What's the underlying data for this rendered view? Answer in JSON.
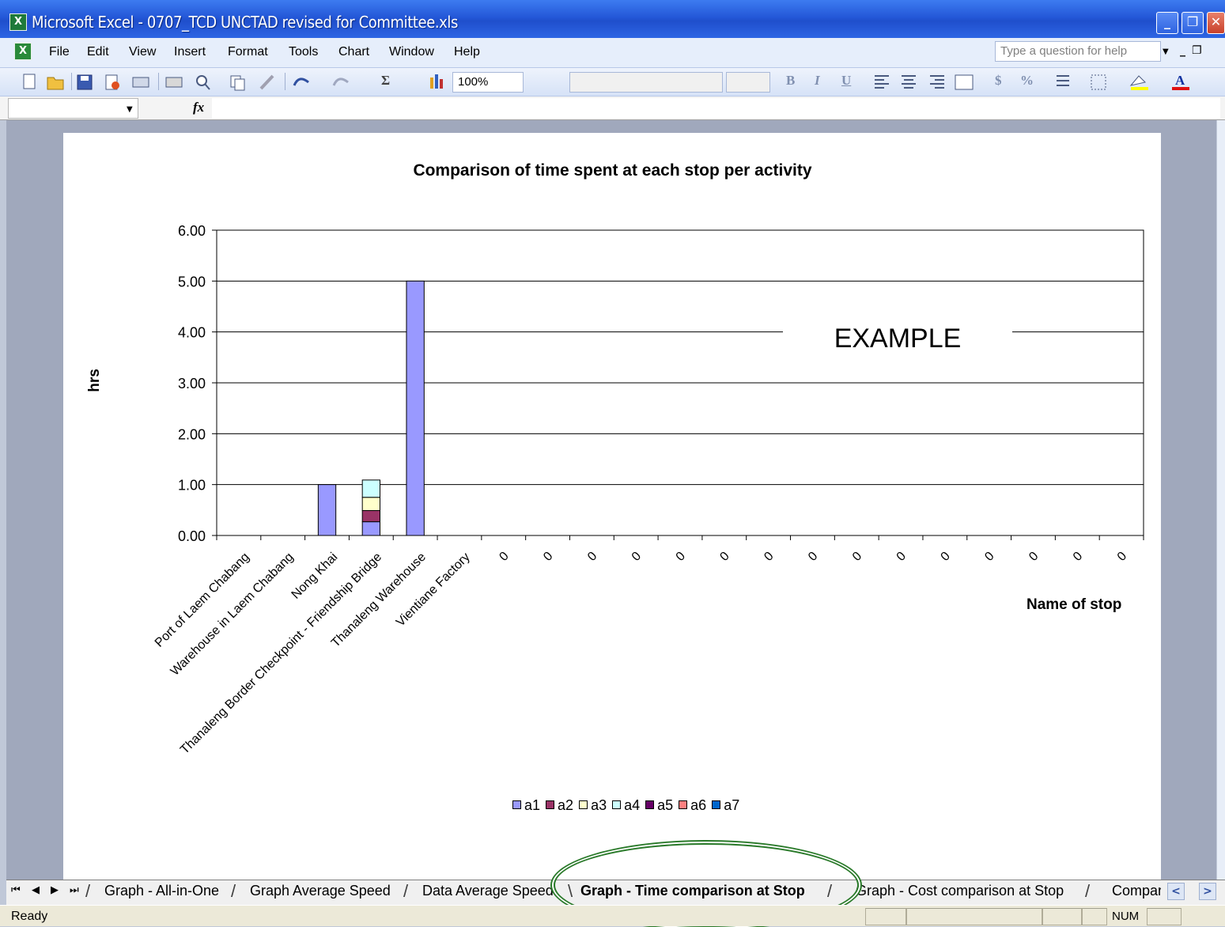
{
  "window": {
    "title": "Microsoft Excel - 0707_TCD UNCTAD revised for Committee.xls",
    "app_icon": "excel-icon"
  },
  "menu": {
    "items": [
      "File",
      "Edit",
      "View",
      "Insert",
      "Format",
      "Tools",
      "Chart",
      "Window",
      "Help"
    ],
    "help_placeholder": "Type a question for help"
  },
  "toolbar": {
    "zoom": "100%",
    "bold": "B",
    "italic": "I",
    "underline": "U",
    "currency": "$",
    "percent": "%",
    "sigma": "Σ"
  },
  "formula_bar": {
    "fx": "fx",
    "name_box": ""
  },
  "chart_data": {
    "type": "bar",
    "stacked": true,
    "title": "Comparison of time spent at each stop per activity",
    "ylabel": "hrs",
    "xlabel": "Name of stop",
    "ylim": [
      0,
      6
    ],
    "yticks": [
      "0.00",
      "1.00",
      "2.00",
      "3.00",
      "4.00",
      "5.00",
      "6.00"
    ],
    "categories": [
      "Port of Laem Chabang",
      "Warehouse in Laem Chabang",
      "Nong Khai",
      "Thanaleng Border Checkpoint - Friendship Bridge",
      "Thanaleng Warehouse",
      "Vientiane Factory",
      "0",
      "0",
      "0",
      "0",
      "0",
      "0",
      "0",
      "0",
      "0",
      "0",
      "0",
      "0",
      "0",
      "0",
      "0"
    ],
    "series": [
      {
        "name": "a1",
        "color": "#9999ff",
        "values": [
          0,
          0,
          1.0,
          0.27,
          5.0,
          0,
          0,
          0,
          0,
          0,
          0,
          0,
          0,
          0,
          0,
          0,
          0,
          0,
          0,
          0,
          0
        ]
      },
      {
        "name": "a2",
        "color": "#993366",
        "values": [
          0,
          0,
          0,
          0.22,
          0,
          0,
          0,
          0,
          0,
          0,
          0,
          0,
          0,
          0,
          0,
          0,
          0,
          0,
          0,
          0,
          0
        ]
      },
      {
        "name": "a3",
        "color": "#ffffcc",
        "values": [
          0,
          0,
          0,
          0.26,
          0,
          0,
          0,
          0,
          0,
          0,
          0,
          0,
          0,
          0,
          0,
          0,
          0,
          0,
          0,
          0,
          0
        ]
      },
      {
        "name": "a4",
        "color": "#ccffff",
        "values": [
          0,
          0,
          0,
          0.34,
          0,
          0,
          0,
          0,
          0,
          0,
          0,
          0,
          0,
          0,
          0,
          0,
          0,
          0,
          0,
          0,
          0
        ]
      },
      {
        "name": "a5",
        "color": "#660066",
        "values": [
          0,
          0,
          0,
          0,
          0,
          0,
          0,
          0,
          0,
          0,
          0,
          0,
          0,
          0,
          0,
          0,
          0,
          0,
          0,
          0,
          0
        ]
      },
      {
        "name": "a6",
        "color": "#ff8080",
        "values": [
          0,
          0,
          0,
          0,
          0,
          0,
          0,
          0,
          0,
          0,
          0,
          0,
          0,
          0,
          0,
          0,
          0,
          0,
          0,
          0,
          0
        ]
      },
      {
        "name": "a7",
        "color": "#0066cc",
        "values": [
          0,
          0,
          0,
          0,
          0,
          0,
          0,
          0,
          0,
          0,
          0,
          0,
          0,
          0,
          0,
          0,
          0,
          0,
          0,
          0,
          0
        ]
      }
    ],
    "grid": true,
    "legend": "bottom",
    "annotation": "EXAMPLE"
  },
  "sheet_tabs": [
    {
      "label": "Graph - All-in-One",
      "active": false
    },
    {
      "label": "Graph Average Speed",
      "active": false
    },
    {
      "label": "Data Average Speed",
      "active": false
    },
    {
      "label": "Graph - Time comparison at Stop",
      "active": true
    },
    {
      "label": "Graph - Cost comparison at Stop",
      "active": false
    },
    {
      "label": "Compar",
      "active": false
    }
  ],
  "status": {
    "text": "Ready",
    "num": "NUM"
  }
}
